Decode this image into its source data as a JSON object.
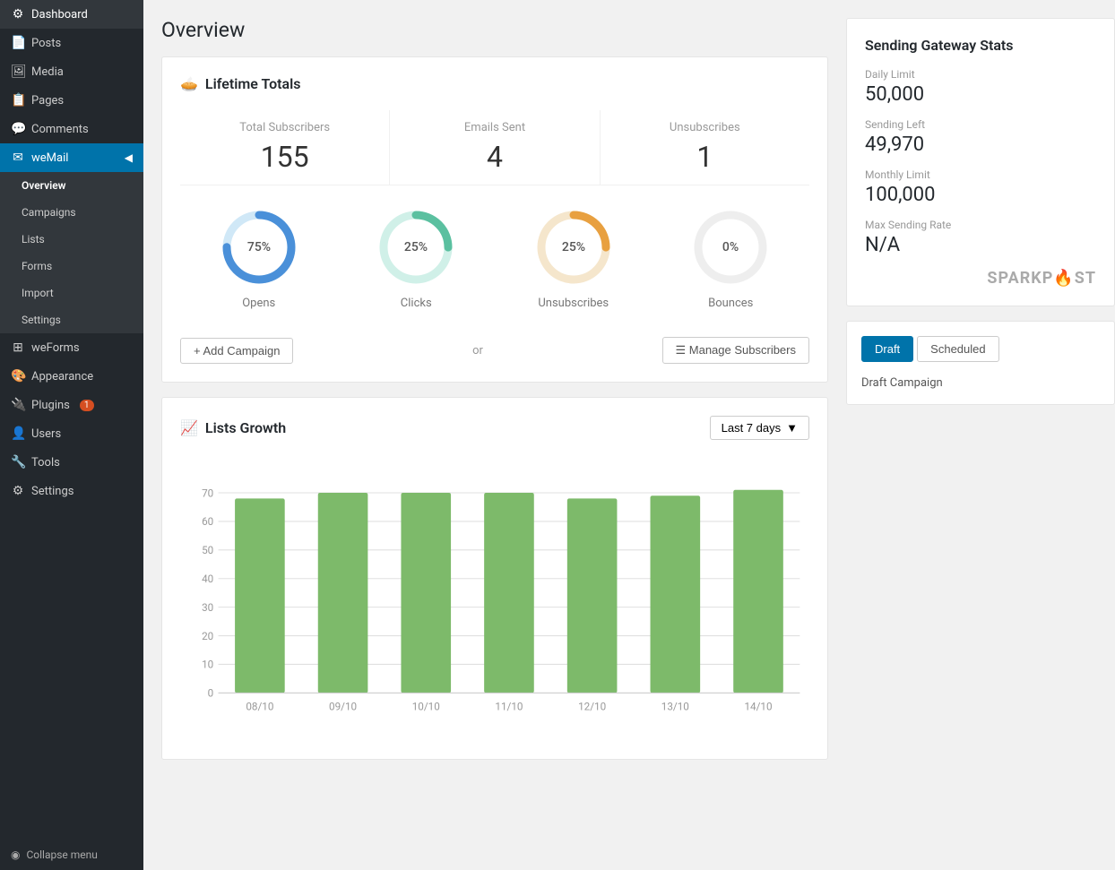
{
  "sidebar": {
    "items": [
      {
        "label": "Dashboard",
        "icon": "⚙",
        "name": "dashboard"
      },
      {
        "label": "Posts",
        "icon": "📄",
        "name": "posts"
      },
      {
        "label": "Media",
        "icon": "🖼",
        "name": "media"
      },
      {
        "label": "Pages",
        "icon": "📋",
        "name": "pages"
      },
      {
        "label": "Comments",
        "icon": "💬",
        "name": "comments"
      },
      {
        "label": "weMail",
        "icon": "✉",
        "name": "wemail"
      },
      {
        "label": "weForms",
        "icon": "⊞",
        "name": "weforms"
      },
      {
        "label": "Appearance",
        "icon": "🎨",
        "name": "appearance"
      },
      {
        "label": "Plugins",
        "icon": "🔌",
        "name": "plugins",
        "badge": "1"
      },
      {
        "label": "Users",
        "icon": "👤",
        "name": "users"
      },
      {
        "label": "Tools",
        "icon": "🔧",
        "name": "tools"
      },
      {
        "label": "Settings",
        "icon": "⚙",
        "name": "settings"
      }
    ],
    "wemail_sub": [
      {
        "label": "Overview",
        "name": "overview"
      },
      {
        "label": "Campaigns",
        "name": "campaigns"
      },
      {
        "label": "Lists",
        "name": "lists"
      },
      {
        "label": "Forms",
        "name": "forms"
      },
      {
        "label": "Import",
        "name": "import"
      },
      {
        "label": "Settings",
        "name": "settings-sub"
      }
    ],
    "collapse_label": "Collapse menu"
  },
  "page": {
    "title": "Overview"
  },
  "lifetime": {
    "header": "Lifetime Totals",
    "stats": [
      {
        "label": "Total Subscribers",
        "value": "155"
      },
      {
        "label": "Emails Sent",
        "value": "4"
      },
      {
        "label": "Unsubscribes",
        "value": "1"
      }
    ],
    "donuts": [
      {
        "label": "Opens",
        "percent": 75,
        "color": "#4a90d9",
        "track": "#d0e8f7",
        "text": "75%"
      },
      {
        "label": "Clicks",
        "percent": 25,
        "color": "#5bc0a0",
        "track": "#d0f0e8",
        "text": "25%"
      },
      {
        "label": "Unsubscribes",
        "percent": 25,
        "color": "#e8a040",
        "track": "#f5e6cc",
        "text": "25%"
      },
      {
        "label": "Bounces",
        "percent": 0,
        "color": "#e0e0e0",
        "track": "#eeeeee",
        "text": "0%"
      }
    ],
    "add_campaign_label": "+ Add Campaign",
    "or_label": "or",
    "manage_subscribers_label": "☰ Manage Subscribers"
  },
  "lists_growth": {
    "title": "Lists Growth",
    "dropdown_label": "Last 7 days",
    "bars": [
      {
        "date": "08/10",
        "value": 68
      },
      {
        "date": "09/10",
        "value": 70
      },
      {
        "date": "10/10",
        "value": 70
      },
      {
        "date": "11/10",
        "value": 70
      },
      {
        "date": "12/10",
        "value": 68
      },
      {
        "date": "13/10",
        "value": 69
      },
      {
        "date": "14/10",
        "value": 71
      }
    ],
    "y_labels": [
      "0",
      "10",
      "20",
      "30",
      "40",
      "50",
      "60",
      "70"
    ],
    "bar_color": "#7dba6a"
  },
  "gateway": {
    "title": "Sending Gateway Stats",
    "stats": [
      {
        "label": "Daily Limit",
        "value": "50,000"
      },
      {
        "label": "Sending Left",
        "value": "49,970"
      },
      {
        "label": "Monthly Limit",
        "value": "100,000"
      },
      {
        "label": "Max Sending Rate",
        "value": "N/A"
      }
    ],
    "logo_text": "SPARKP",
    "logo_suffix": "ST"
  },
  "campaigns": {
    "tabs": [
      {
        "label": "Draft",
        "name": "draft",
        "active": true
      },
      {
        "label": "Scheduled",
        "name": "scheduled",
        "active": false
      }
    ],
    "draft_campaign_label": "Draft Campaign"
  }
}
